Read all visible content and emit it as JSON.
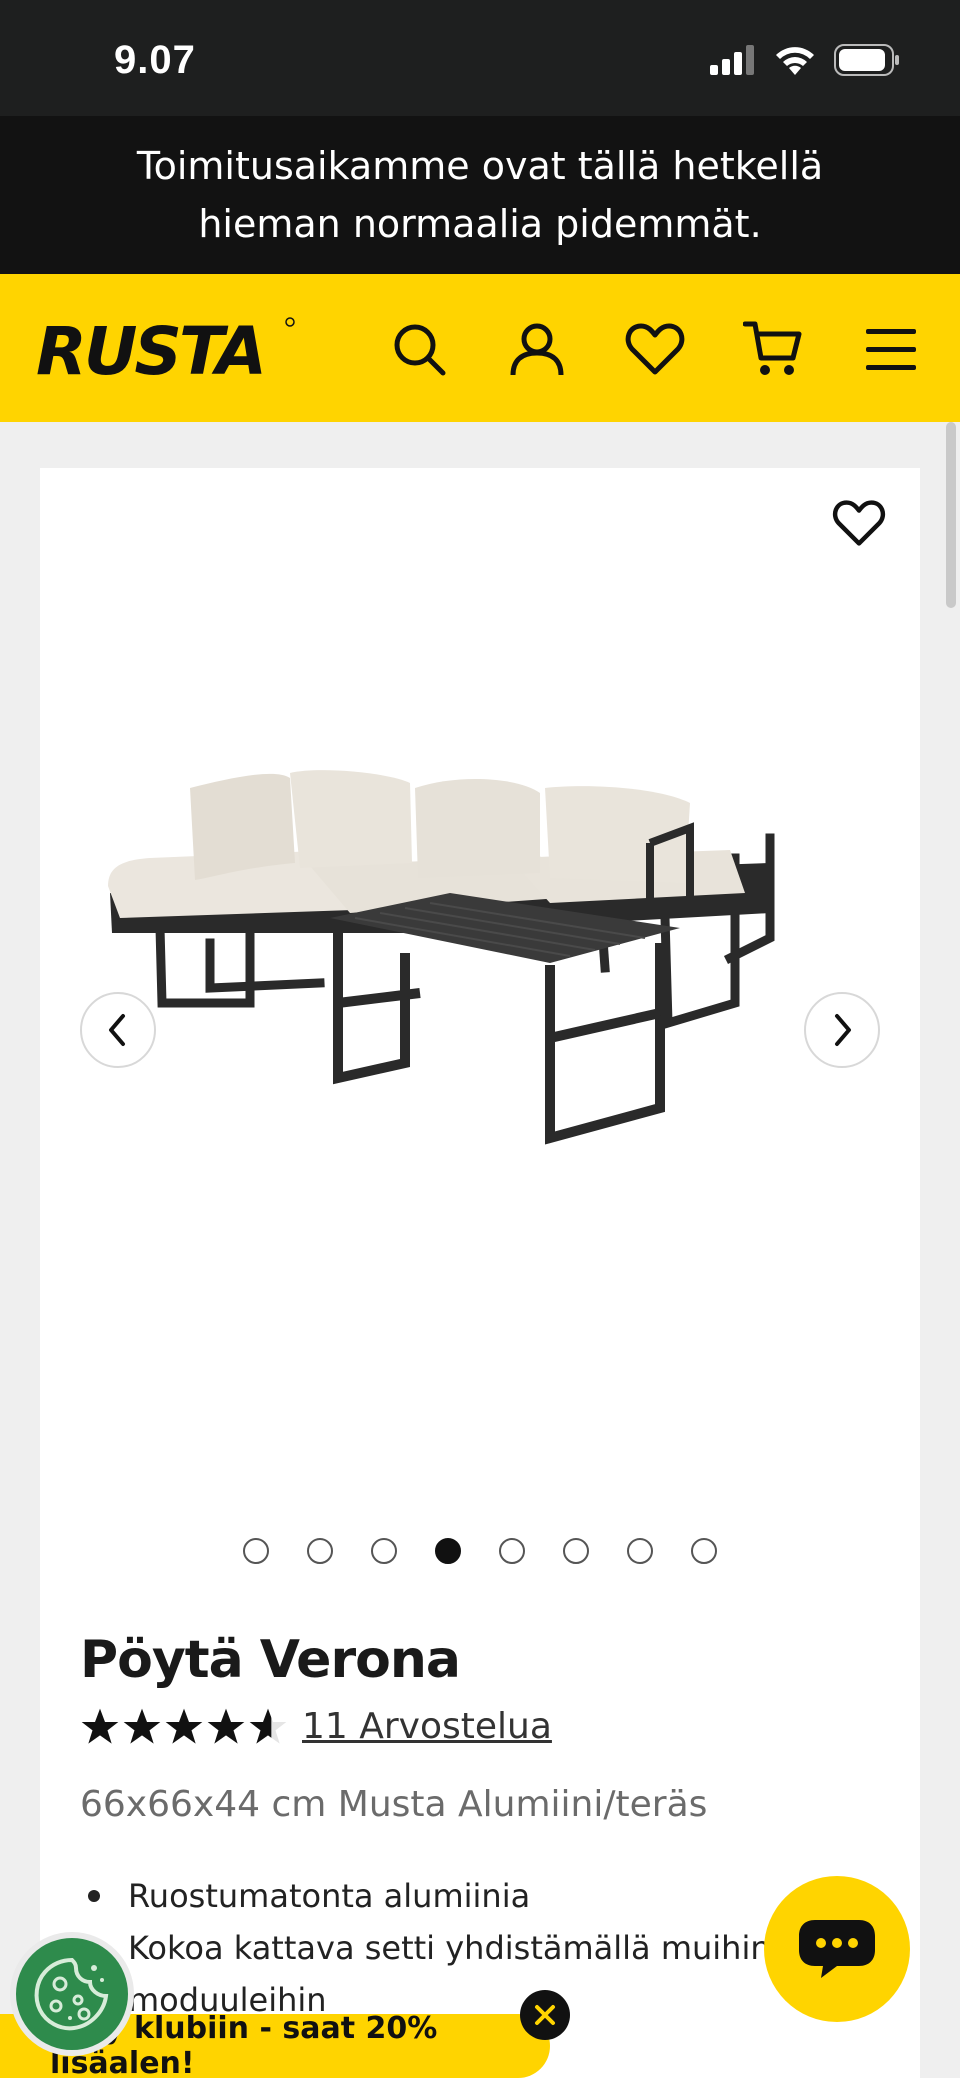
{
  "status_bar": {
    "time": "9.07"
  },
  "notice": {
    "text": "Toimitusaikamme ovat tällä hetkellä hieman normaalia pidemmät."
  },
  "header": {
    "logo_text": "RUSTA"
  },
  "product": {
    "title": "Pöytä Verona",
    "rating": 4.6,
    "rating_max": 5,
    "reviews_label": "11 Arvostelua",
    "subtitle": "66x66x44 cm Musta Alumiini/teräs",
    "bullets": [
      "Ruostumatonta alumiinia",
      "Kokoa kattava setti yhdistämällä muihin moduuleihin"
    ],
    "gallery": {
      "total_images": 8,
      "active_index": 4
    }
  },
  "promo": {
    "club_text": "Liity klubiin - saat 20% lisäalen!"
  },
  "colors": {
    "brand_yellow": "#ffd400",
    "dark": "#121212",
    "cookie_green": "#2e8b4c"
  },
  "icons": [
    "search-icon",
    "user-icon",
    "heart-icon",
    "cart-icon",
    "menu-icon",
    "chevron-left-icon",
    "chevron-right-icon",
    "chat-icon",
    "close-icon",
    "cookie-icon"
  ]
}
